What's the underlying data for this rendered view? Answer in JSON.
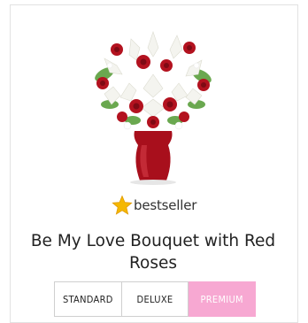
{
  "product": {
    "badge_label": "bestseller",
    "title": "Be My Love Bouquet with Red Roses"
  },
  "options": [
    {
      "label": "STANDARD",
      "selected": false
    },
    {
      "label": "DELUXE",
      "selected": false
    },
    {
      "label": "PREMIUM",
      "selected": true
    }
  ],
  "colors": {
    "accent_pink": "#f7a8d2",
    "rose_red": "#b3121f",
    "star_gold": "#f5b800"
  },
  "icons": {
    "badge": "star-icon"
  }
}
